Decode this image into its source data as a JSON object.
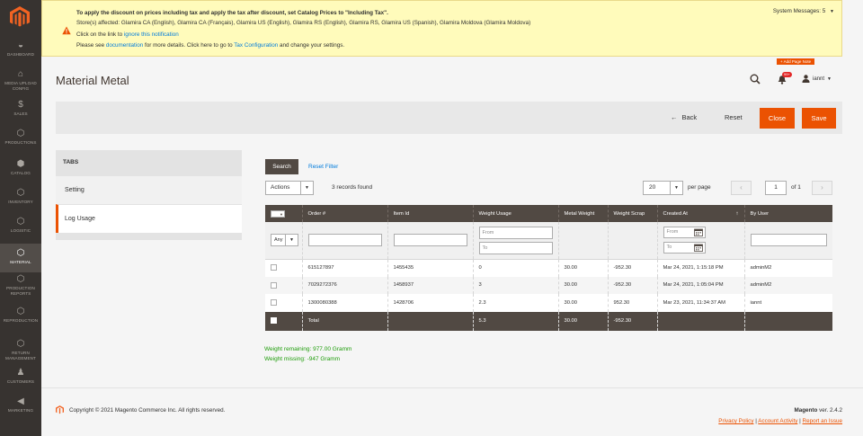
{
  "sidebar": {
    "items": [
      {
        "label": "DASHBOARD",
        "icon": "dashboard-icon"
      },
      {
        "label": "MEDIA UPLOAD CONFIG",
        "icon": "media-upload-icon"
      },
      {
        "label": "SALES",
        "icon": "dollar-icon"
      },
      {
        "label": "PRODUCTIONS",
        "icon": "hexagon-icon"
      },
      {
        "label": "CATALOG",
        "icon": "cube-icon"
      },
      {
        "label": "INVENTORY",
        "icon": "hexagon-icon"
      },
      {
        "label": "LOGISTIC",
        "icon": "hexagon-icon"
      },
      {
        "label": "MATERIAL",
        "icon": "hexagon-icon"
      },
      {
        "label": "PRODUCTION REPORTS",
        "icon": "hexagon-icon"
      },
      {
        "label": "REPRODUCTION",
        "icon": "hexagon-icon"
      },
      {
        "label": "RETURN MANAGEMENT",
        "icon": "hexagon-icon"
      },
      {
        "label": "CUSTOMERS",
        "icon": "person-icon"
      },
      {
        "label": "MARKETING",
        "icon": "megaphone-icon"
      }
    ],
    "active_index": 7
  },
  "notice": {
    "line1": "To apply the discount on prices including tax and apply the tax after discount, set Catalog Prices to \"Including Tax\".",
    "line2": "Store(s) affected: Glamira CA (English), Glamira CA (Français), Glamira US (English), Glamira RS (English), Glamira RS, Glamira US (Spanish), Glamira Moldova (Glamira Moldova)",
    "line3_prefix": "Click on the link to",
    "line3_link": "ignore this notification",
    "line4_prefix": "Please see",
    "line4_link1": "documentation",
    "line4_mid": "for more details. Click here to go to",
    "line4_link2": "Tax Configuration",
    "line4_suffix": "and change your settings.",
    "system_messages": "System Messages: 5"
  },
  "header": {
    "title": "Material Metal",
    "add_page_note": "+ Add Page Note",
    "notification_count": "99+",
    "user_name": "iannt"
  },
  "actions": {
    "back": "Back",
    "reset": "Reset",
    "close": "Close",
    "save": "Save"
  },
  "tabs": {
    "title": "TABS",
    "items": [
      {
        "label": "Setting"
      },
      {
        "label": "Log Usage"
      }
    ],
    "active_index": 1
  },
  "grid": {
    "search_button": "Search",
    "reset_filter": "Reset Filter",
    "mass_action": "Actions",
    "records_found": "3 records found",
    "per_page_value": "20",
    "per_page_label": "per page",
    "current_page": "1",
    "of_pages": "of 1",
    "columns": [
      "Order #",
      "Item Id",
      "Weight Usage",
      "Metal Weight",
      "Weight Scrap",
      "Created At",
      "By User"
    ],
    "filter_any": "Any",
    "filter_from": "From",
    "filter_to": "To",
    "rows": [
      {
        "order": "615127897",
        "item_id": "1455435",
        "weight_usage": "0",
        "metal_weight": "30.00",
        "weight_scrap": "-952.30",
        "created_at": "Mar 24, 2021, 1:15:18 PM",
        "by_user": "adminM2"
      },
      {
        "order": "7029272376",
        "item_id": "1458937",
        "weight_usage": "3",
        "metal_weight": "30.00",
        "weight_scrap": "-952.30",
        "created_at": "Mar 24, 2021, 1:05:04 PM",
        "by_user": "adminM2"
      },
      {
        "order": "1300080388",
        "item_id": "1428706",
        "weight_usage": "2.3",
        "metal_weight": "30.00",
        "weight_scrap": "952.30",
        "created_at": "Mar 23, 2021, 11:34:37 AM",
        "by_user": "iannt"
      }
    ],
    "total": {
      "label": "Total",
      "weight_usage": "5.3",
      "metal_weight": "30.00",
      "weight_scrap": "-952.30"
    }
  },
  "summary": {
    "weight_remaining": "Weight remaining: 977.00 Gramm",
    "weight_missing": "Weight missing: -947 Gramm"
  },
  "footer": {
    "copyright": "Copyright © 2021 Magento Commerce Inc. All rights reserved.",
    "brand": "Magento",
    "version": "ver. 2.4.2",
    "links": [
      "Privacy Policy",
      "Account Activity",
      "Report an Issue"
    ]
  },
  "colors": {
    "accent": "#eb5202",
    "sidebar": "#373330",
    "grid_header": "#514943",
    "link": "#007bdb",
    "success": "#1f9d0b"
  }
}
